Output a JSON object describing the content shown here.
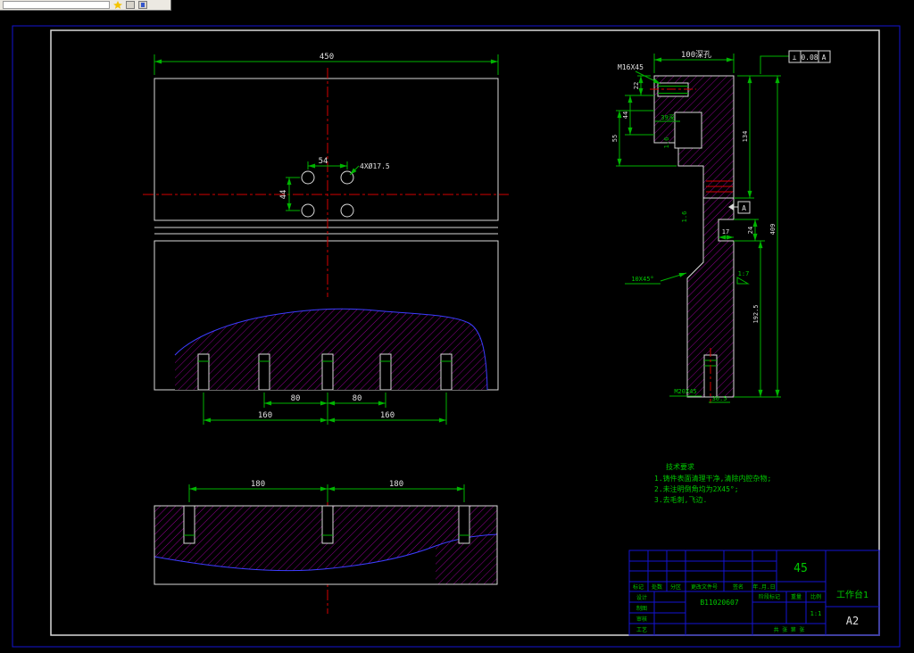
{
  "front_view": {
    "dim_width": "450",
    "dim_hole_h": "54",
    "dim_hole_v": "44",
    "hole_callout": "4XØ17.5"
  },
  "section_view": {
    "dim_80a": "80",
    "dim_80b": "80",
    "dim_160a": "160",
    "dim_160b": "160"
  },
  "bottom_view": {
    "dim_180a": "180",
    "dim_180b": "180"
  },
  "side_view": {
    "stud_top": "M16X45",
    "dim_top": "100深孔",
    "fcf_symbol": "⊥",
    "fcf_value": "0.08",
    "fcf_datum": "A",
    "dim_22": "22",
    "dim_44": "44",
    "dim_55": "55",
    "thread_depth": "39深",
    "rough_a": "1.6",
    "rough_b": "1.6",
    "dim_134": "134",
    "dim_409": "409",
    "dim_24": "24",
    "dim_17": "17",
    "dim_192_5": "192.5",
    "chamfer": "10X45°",
    "taper": "1:7",
    "datum": "A",
    "stud_bottom": "M20X45",
    "dim_30_5": "30.5"
  },
  "tech_req": {
    "title": "技术要求",
    "item1": "1.铸件表面清理干净,清除内腔杂物;",
    "item2": "2.未注明倒角均为2X45°;",
    "item3": "3.去毛刺,飞边."
  },
  "title_block": {
    "material": "45",
    "drawing_no": "B11020607",
    "part_name": "工作台1",
    "sheet_size": "A2",
    "col_mark": "标记",
    "col_count": "处数",
    "col_zone": "分区",
    "col_doc": "更改文件号",
    "col_sign": "签名",
    "col_date": "年.月.日",
    "row_design": "设计",
    "row_draw": "制图",
    "row_check": "审核",
    "row_process": "工艺",
    "stage": "阶段标记",
    "weight": "重量",
    "scale": "比例",
    "scale_value": "1:1",
    "sheets": "共 张 第 张"
  }
}
